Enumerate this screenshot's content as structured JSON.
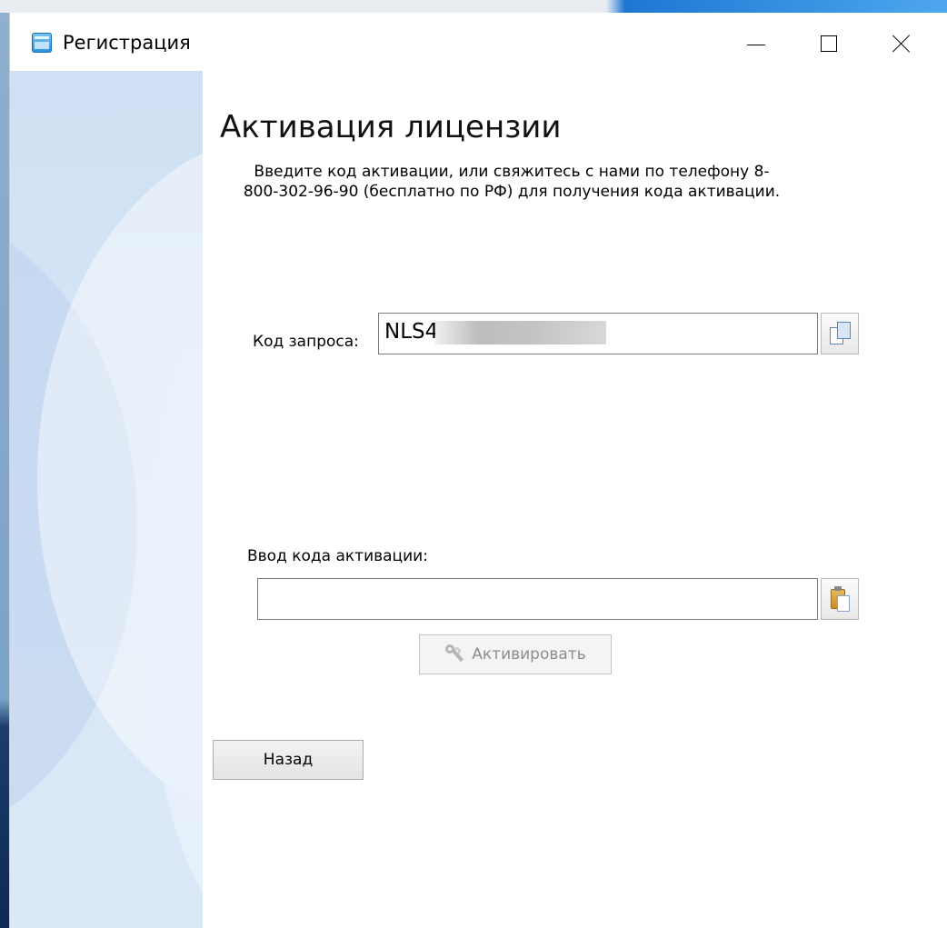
{
  "window": {
    "title": "Регистрация",
    "controls": {
      "minimize": "minimize-icon",
      "maximize": "maximize-icon",
      "close": "close-icon"
    }
  },
  "main": {
    "heading": "Активация лицензии",
    "description": "Введите код активации, или свяжитесь с нами по телефону 8-800-302-96-90 (бесплатно по РФ) для получения кода активации.",
    "request_code": {
      "label": "Код запроса:",
      "value": "NLS4",
      "copy_icon": "copy-icon"
    },
    "activation_code": {
      "label": "Ввод кода активации:",
      "value": "",
      "paste_icon": "paste-icon"
    },
    "activate_button": {
      "label": "Активировать",
      "icon": "keys-icon",
      "enabled": false
    },
    "back_button": {
      "label": "Назад"
    }
  },
  "colors": {
    "accent": "#1e77d2",
    "side_panel": "#d6e5f6",
    "disabled_text": "#8d8d8d"
  }
}
